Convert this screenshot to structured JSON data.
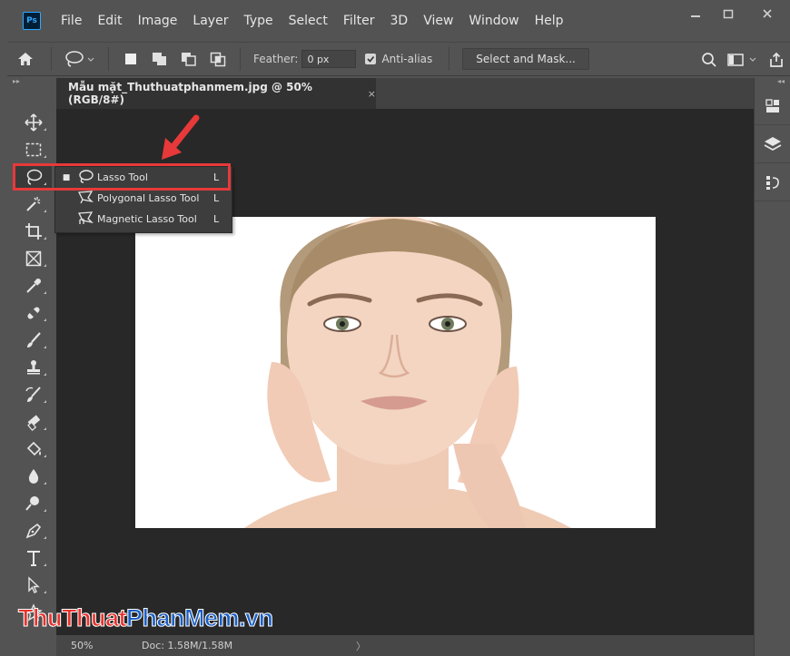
{
  "app": {
    "logo": "Ps",
    "menu": [
      "File",
      "Edit",
      "Image",
      "Layer",
      "Type",
      "Select",
      "Filter",
      "3D",
      "View",
      "Window",
      "Help"
    ]
  },
  "options_bar": {
    "feather_label": "Feather:",
    "feather_value": "0 px",
    "anti_alias_label": "Anti-alias",
    "anti_alias_checked": true,
    "select_mask_label": "Select and Mask..."
  },
  "document": {
    "tab_title": "Mẫu mặt_Thuthuatphanmem.jpg @ 50% (RGB/8#)",
    "close_glyph": "×"
  },
  "flyout": {
    "items": [
      {
        "label": "Lasso Tool",
        "shortcut": "L",
        "active": true,
        "icon": "lasso-icon"
      },
      {
        "label": "Polygonal Lasso Tool",
        "shortcut": "L",
        "active": false,
        "icon": "polygonal-lasso-icon"
      },
      {
        "label": "Magnetic Lasso Tool",
        "shortcut": "L",
        "active": false,
        "icon": "magnetic-lasso-icon"
      }
    ]
  },
  "status": {
    "zoom": "50%",
    "doc_size": "Doc: 1.58M/1.58M",
    "chevron": "〉"
  },
  "watermark": {
    "part1": "ThuThuat",
    "part2": "PhanMem",
    "part3": ".vn"
  },
  "colors": {
    "highlight": "#e8393a",
    "accent_blue": "#31a8ff",
    "watermark_red": "#e8322d",
    "watermark_blue": "#1b5fc5"
  }
}
